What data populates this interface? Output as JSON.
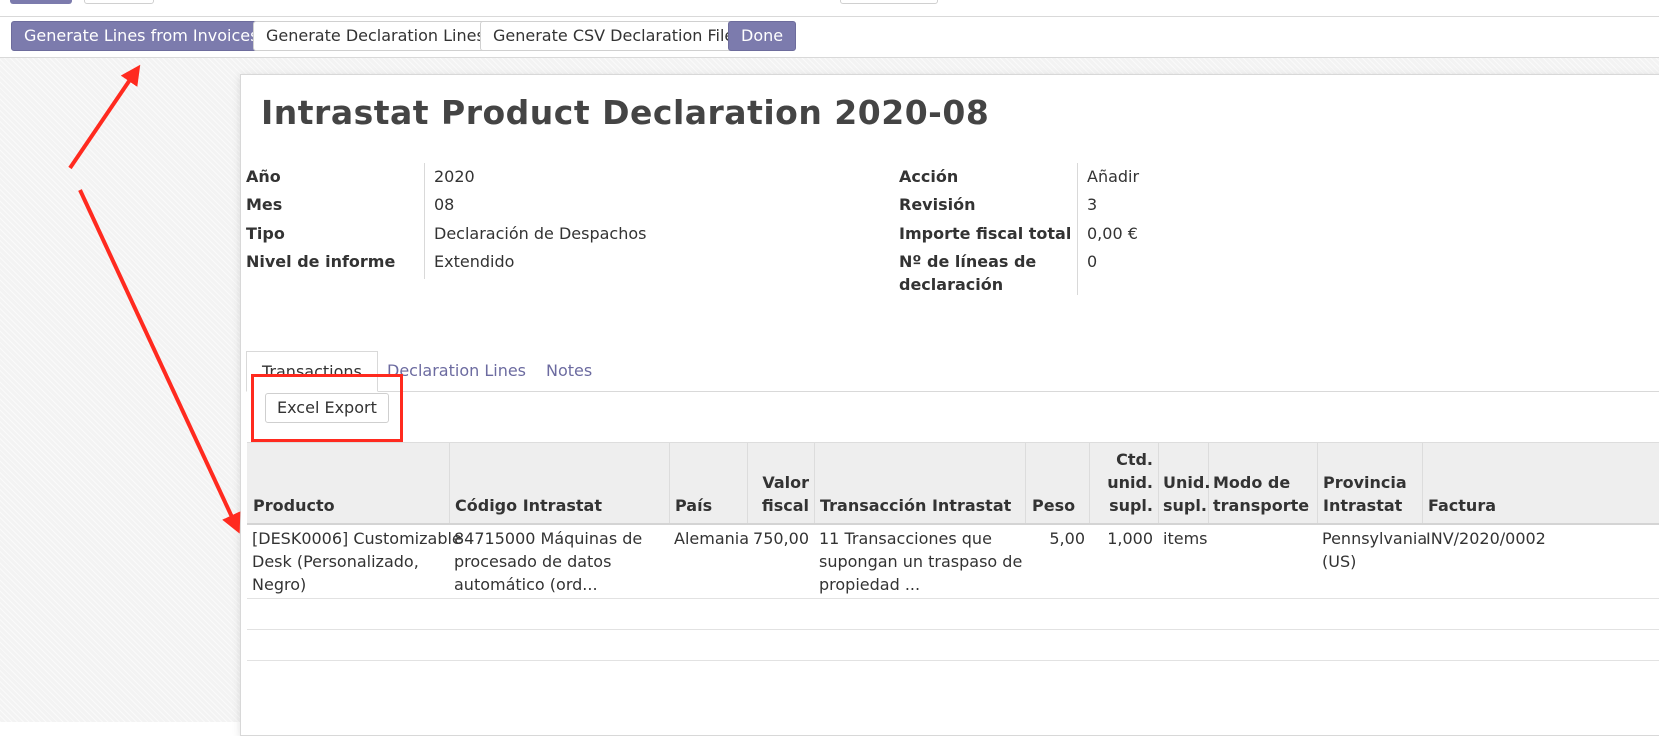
{
  "statusbar": {
    "generate_lines_from_invoices": "Generate Lines from Invoices",
    "generate_declaration_lines": "Generate Declaration Lines",
    "generate_csv_declaration_file": "Generate CSV Declaration File",
    "done": "Done"
  },
  "form": {
    "title": "Intrastat Product Declaration 2020-08",
    "fields_left": [
      {
        "label": "Año",
        "value": "2020"
      },
      {
        "label": "Mes",
        "value": "08"
      },
      {
        "label": "Tipo",
        "value": "Declaración de Despachos"
      },
      {
        "label": "Nivel de informe",
        "value": "Extendido"
      }
    ],
    "fields_right": [
      {
        "label": "Acción",
        "value": "Añadir"
      },
      {
        "label": "Revisión",
        "value": "3"
      },
      {
        "label": "Importe fiscal total",
        "value": "0,00 €"
      },
      {
        "label": "Nº de líneas de",
        "label2": "declaración",
        "value": "0"
      }
    ]
  },
  "tabs": [
    {
      "label": "Transactions",
      "active": true
    },
    {
      "label": "Declaration Lines",
      "active": false
    },
    {
      "label": "Notes",
      "active": false
    }
  ],
  "excel_export": "Excel Export",
  "table": {
    "headers": {
      "producto": "Producto",
      "codigo": "Código Intrastat",
      "pais": "País",
      "valor_1": "Valor",
      "valor_2": "fiscal",
      "transaccion": "Transacción Intrastat",
      "peso": "Peso",
      "ctd_1": "Ctd.",
      "ctd_2": "unid.",
      "ctd_3": "supl.",
      "unid_1": "Unid.",
      "unid_2": "supl.",
      "modo_1": "Modo de",
      "modo_2": "transporte",
      "prov_1": "Provincia",
      "prov_2": "Intrastat",
      "factura": "Factura"
    },
    "rows": [
      {
        "producto": [
          "[DESK0006] Customizable",
          "Desk (Personalizado,",
          "Negro)"
        ],
        "codigo": [
          "84715000 Máquinas de",
          "procesado de datos",
          "automático (ord..."
        ],
        "pais": "Alemania",
        "valor": "750,00",
        "transaccion": [
          "11 Transacciones que",
          "supongan un traspaso de",
          "propiedad ..."
        ],
        "peso": "5,00",
        "ctd": "1,000",
        "unid": "items",
        "modo": "",
        "provincia": [
          "Pennsylvania",
          "(US)"
        ],
        "factura": "INV/2020/0002"
      }
    ]
  },
  "annotation_color": "#ff2a1f",
  "accent_color": "#7c7bad"
}
